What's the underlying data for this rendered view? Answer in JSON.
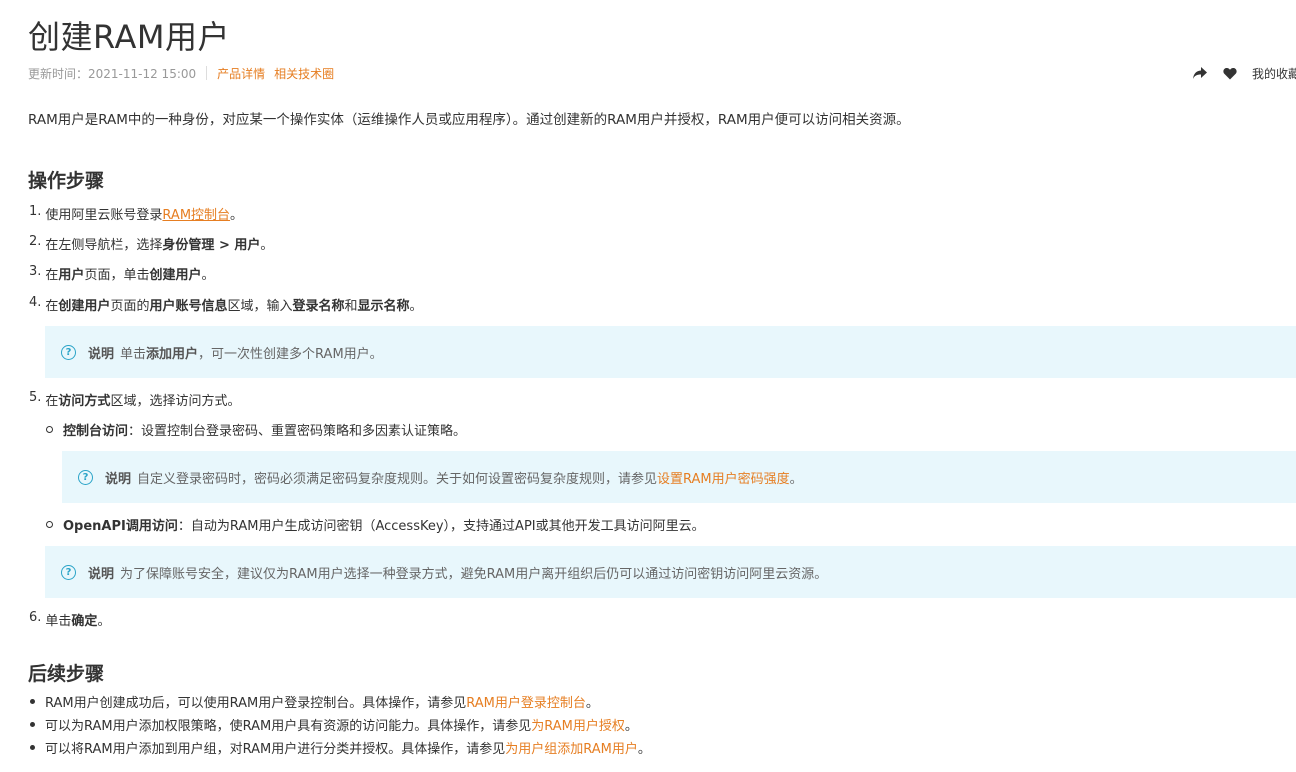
{
  "title": "创建RAM用户",
  "meta": {
    "updated": "更新时间：2021-11-12 15:00",
    "links": [
      "产品详情",
      "相关技术圈"
    ]
  },
  "actions": {
    "share_icon": "share-arrow-icon",
    "fav_icon": "heart-icon",
    "fav_label": "我的收藏"
  },
  "intro": "RAM用户是RAM中的一种身份，对应某一个操作实体（运维操作人员或应用程序）。通过创建新的RAM用户并授权，RAM用户便可以访问相关资源。",
  "section1": {
    "heading": "操作步骤",
    "step1": {
      "num": "1.",
      "t1": "使用阿里云账号登录",
      "link": "RAM控制台",
      "t2": "。"
    },
    "step2": {
      "num": "2.",
      "t1": "在左侧导航栏，选择",
      "b1": "身份管理 > 用户",
      "t2": "。"
    },
    "step3": {
      "num": "3.",
      "t1": "在",
      "b1": "用户",
      "t2": "页面，单击",
      "b2": "创建用户",
      "t3": "。"
    },
    "step4": {
      "num": "4.",
      "t1": "在",
      "b1": "创建用户",
      "t2": "页面的",
      "b2": "用户账号信息",
      "t3": "区域，输入",
      "b3": "登录名称",
      "t4": "和",
      "b4": "显示名称",
      "t5": "。"
    },
    "note1": {
      "label": "说明",
      "t1": "单击",
      "b1": "添加用户",
      "t2": "，可一次性创建多个RAM用户。"
    },
    "step5": {
      "num": "5.",
      "t1": "在",
      "b1": "访问方式",
      "t2": "区域，选择访问方式。"
    },
    "sub1": {
      "b1": "控制台访问",
      "t1": "：设置控制台登录密码、重置密码策略和多因素认证策略。"
    },
    "note2": {
      "label": "说明",
      "t1": "自定义登录密码时，密码必须满足密码复杂度规则。关于如何设置密码复杂度规则，请参见",
      "link": "设置RAM用户密码强度",
      "t2": "。"
    },
    "sub2": {
      "b1": "OpenAPI调用访问",
      "t1": "：自动为RAM用户生成访问密钥（AccessKey），支持通过API或其他开发工具访问阿里云。"
    },
    "note3": {
      "label": "说明",
      "t1": "为了保障账号安全，建议仅为RAM用户选择一种登录方式，避免RAM用户离开组织后仍可以通过访问密钥访问阿里云资源。"
    },
    "step6": {
      "num": "6.",
      "t1": "单击",
      "b1": "确定",
      "t2": "。"
    }
  },
  "section2": {
    "heading": "后续步骤",
    "b1": {
      "t1": "RAM用户创建成功后，可以使用RAM用户登录控制台。具体操作，请参见",
      "link": "RAM用户登录控制台",
      "t2": "。"
    },
    "b2": {
      "t1": "可以为RAM用户添加权限策略，使RAM用户具有资源的访问能力。具体操作，请参见",
      "link": "为RAM用户授权",
      "t2": "。"
    },
    "b3": {
      "t1": "可以将RAM用户添加到用户组，对RAM用户进行分类并授权。具体操作，请参见",
      "link": "为用户组添加RAM用户",
      "t2": "。"
    }
  },
  "colors": {
    "accent": "#e67e22",
    "note_bg": "#e8f7fc",
    "note_icon": "#2ba4c8"
  }
}
